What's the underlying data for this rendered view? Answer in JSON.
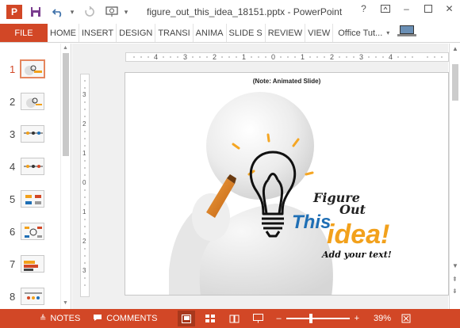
{
  "window": {
    "title": "figure_out_this_idea_18151.pptx - PowerPoint",
    "app_badge": "P",
    "help": "?"
  },
  "quick_access": [
    "save-icon",
    "undo-icon",
    "redo-icon",
    "slideshow-icon"
  ],
  "ribbon": {
    "file": "FILE",
    "tabs": [
      "HOME",
      "INSERT",
      "DESIGN",
      "TRANSI",
      "ANIMA",
      "SLIDE S",
      "REVIEW",
      "VIEW"
    ],
    "account": "Office Tut..."
  },
  "thumbnails": [
    {
      "number": "1",
      "active": true
    },
    {
      "number": "2",
      "active": false
    },
    {
      "number": "3",
      "active": false
    },
    {
      "number": "4",
      "active": false
    },
    {
      "number": "5",
      "active": false
    },
    {
      "number": "6",
      "active": false
    },
    {
      "number": "7",
      "active": false
    },
    {
      "number": "8",
      "active": false
    }
  ],
  "rulers": {
    "horizontal": [
      "4",
      "3",
      "2",
      "1",
      "0",
      "1",
      "2",
      "3",
      "4"
    ],
    "vertical": [
      "3",
      "2",
      "1",
      "0",
      "1",
      "2",
      "3"
    ]
  },
  "slide": {
    "note": "(Note: Animated Slide)",
    "headline_line1": "Figure",
    "headline_line2": "Out",
    "headline_this": "This",
    "headline_idea": "idea!",
    "subtext": "Add your text!"
  },
  "status_bar": {
    "notes": "NOTES",
    "comments": "COMMENTS",
    "zoom_minus": "–",
    "zoom_plus": "+",
    "zoom": "39%",
    "zoom_fraction": 0.39
  },
  "colors": {
    "accent": "#d24726",
    "title_blue": "#1f6fb5",
    "idea_orange": "#f2a11c",
    "bulb_rays": "#f5a623"
  }
}
